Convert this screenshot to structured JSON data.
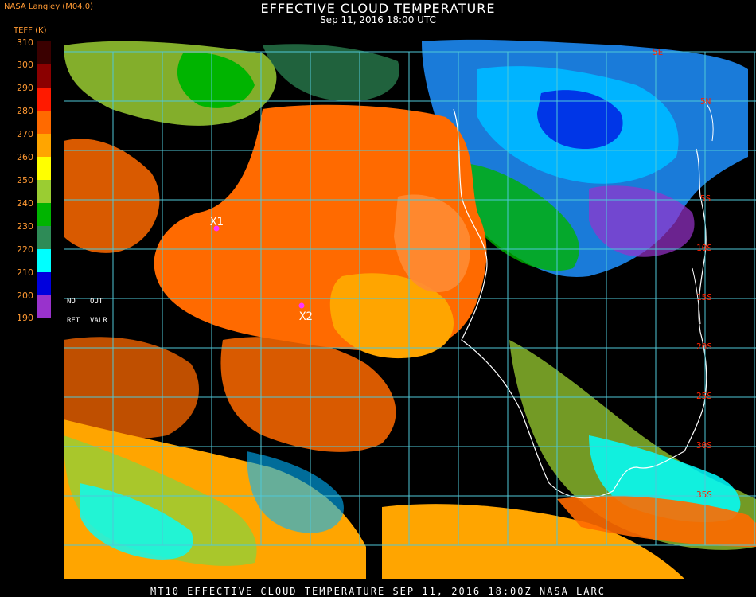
{
  "header": {
    "title": "EFFECTIVE CLOUD TEMPERATURE",
    "subtitle": "Sep 11, 2016 18:00 UTC",
    "org": "NASA Langley (M04.0)",
    "units": "TEFF (K)"
  },
  "legend": {
    "scale": [
      {
        "label": "310",
        "color": "#3a0000"
      },
      {
        "label": "300",
        "color": "#8b0000"
      },
      {
        "label": "290",
        "color": "#ff1a00"
      },
      {
        "label": "280",
        "color": "#ff6a00"
      },
      {
        "label": "270",
        "color": "#ffa500"
      },
      {
        "label": "260",
        "color": "#ffff00"
      },
      {
        "label": "250",
        "color": "#9acd32"
      },
      {
        "label": "240",
        "color": "#00b400"
      },
      {
        "label": "230",
        "color": "#2e8b57"
      },
      {
        "label": "220",
        "color": "#00ffff"
      },
      {
        "label": "210",
        "color": "#1e90ff"
      },
      {
        "label": "200",
        "color": "#0000dd"
      },
      {
        "label": "190",
        "color": "#9932cc"
      }
    ],
    "no_label": "NO",
    "out_label": "OUT",
    "ret_label": "RET",
    "valr_label": "VALR"
  },
  "map": {
    "grid_color": "#4fc8d8",
    "lat_labels": [
      "5N",
      "5S",
      "10S",
      "15S",
      "20S",
      "25S",
      "30S",
      "35S"
    ],
    "lon_labels": [
      "5E"
    ],
    "markers": [
      {
        "label": "X1",
        "color": "#ff33ff"
      },
      {
        "label": "X2",
        "color": "#ff33ff"
      }
    ]
  },
  "footer": {
    "text": "MT10  EFFECTIVE CLOUD TEMPERATURE  SEP 11, 2016 18:00Z  NASA LARC"
  }
}
